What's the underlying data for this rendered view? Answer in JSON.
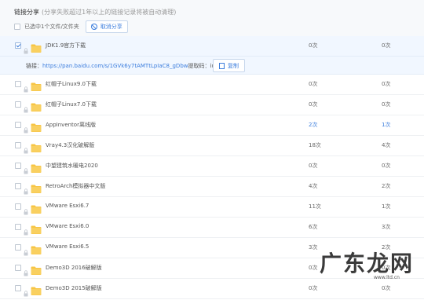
{
  "header": {
    "title": "链接分享",
    "note": "(分享失败超过1年以上的链接记录将被自动清理)",
    "selection_text": "已选中1个文件/文件夹",
    "cancel_share": "取消分享"
  },
  "link_info": {
    "prefix": "链接：",
    "url": "https://pan.baidu.com/s/1GVk6y7tAMTtLpIaC8_gDbw",
    "code_label": "提取码：",
    "code": "iutu",
    "copy": "复制"
  },
  "rows": [
    {
      "name": "JDK1.9官方下载",
      "c1": "0次",
      "c2": "0次",
      "selected": true
    },
    {
      "name": "红帽子Linux9.0下载",
      "c1": "0次",
      "c2": "0次"
    },
    {
      "name": "红帽子Linux7.0下载",
      "c1": "0次",
      "c2": "0次"
    },
    {
      "name": "AppInventor离线版",
      "c1": "2次",
      "c2": "1次",
      "blue": true
    },
    {
      "name": "Vray4.3汉化破解版",
      "c1": "18次",
      "c2": "4次"
    },
    {
      "name": "中望建筑水暖电2020",
      "c1": "0次",
      "c2": "0次"
    },
    {
      "name": "RetroArch模拟器中文版",
      "c1": "4次",
      "c2": "2次"
    },
    {
      "name": "VMware Esxi6.7",
      "c1": "11次",
      "c2": "1次"
    },
    {
      "name": "VMware Esxi6.0",
      "c1": "6次",
      "c2": "3次"
    },
    {
      "name": "VMware Esxi6.5",
      "c1": "3次",
      "c2": "2次"
    },
    {
      "name": "Demo3D 2016破解版",
      "c1": "0次",
      "c2": "0次"
    },
    {
      "name": "Demo3D 2015破解版",
      "c1": "0次",
      "c2": "0次"
    }
  ],
  "watermark": {
    "text": "广东龙网",
    "url": "www.ltd.cn"
  },
  "colors": {
    "folder": "#f7c544",
    "link": "#3b7ddd",
    "selected_bg": "#f1f7ff"
  }
}
